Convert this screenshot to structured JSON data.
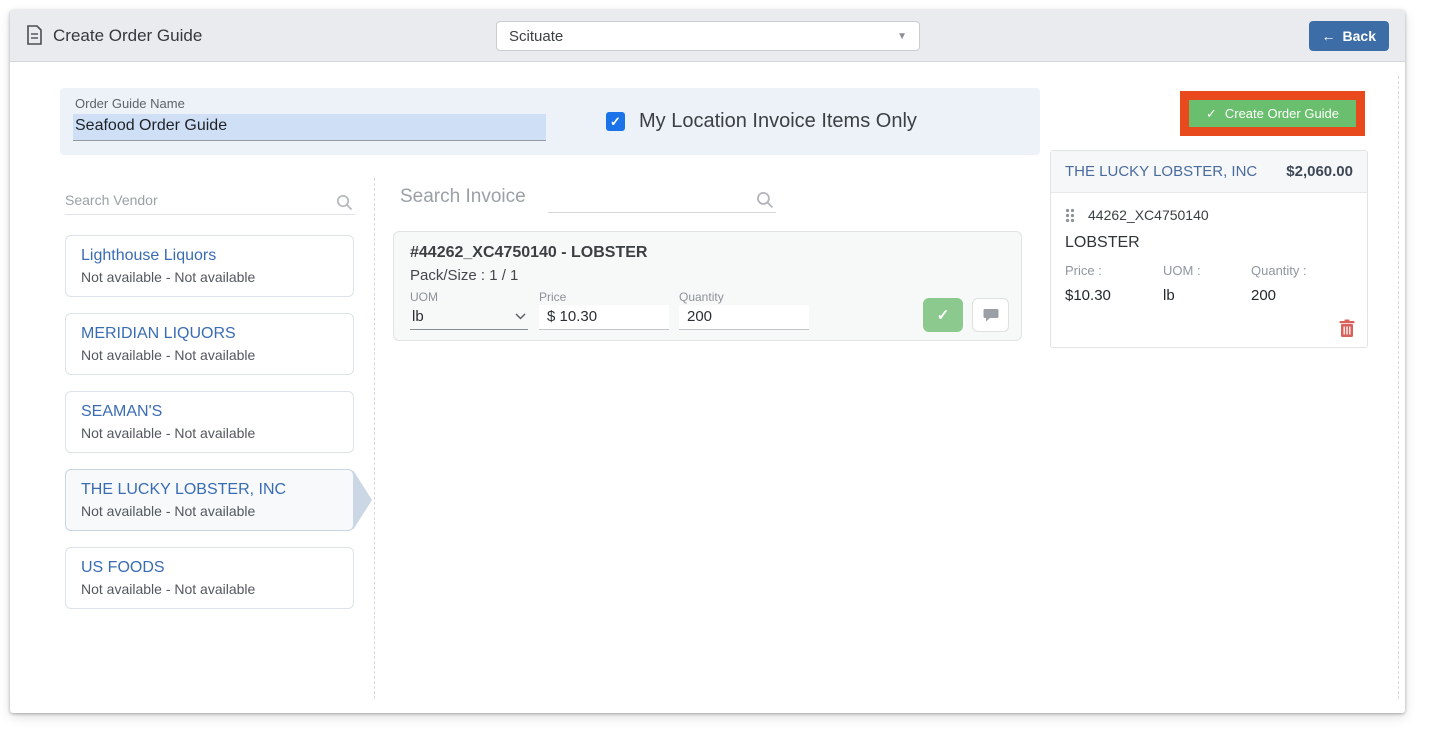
{
  "header": {
    "title": "Create Order Guide",
    "location_dropdown": {
      "value": "Scituate"
    },
    "back_button": {
      "label": "Back"
    }
  },
  "form": {
    "order_guide_name": {
      "label": "Order Guide Name",
      "value": "Seafood Order Guide"
    },
    "my_location_checkbox": {
      "label": "My Location Invoice Items Only",
      "checked": true
    }
  },
  "vendors": {
    "search_placeholder": "Search Vendor",
    "items": [
      {
        "name": "Lighthouse Liquors",
        "availability": "Not available - Not available",
        "selected": false
      },
      {
        "name": "MERIDIAN LIQUORS",
        "availability": "Not available - Not available",
        "selected": false
      },
      {
        "name": "SEAMAN'S",
        "availability": "Not available - Not available",
        "selected": false
      },
      {
        "name": "THE LUCKY LOBSTER, INC",
        "availability": "Not available - Not available",
        "selected": true
      },
      {
        "name": "US FOODS",
        "availability": "Not available - Not available",
        "selected": false
      }
    ]
  },
  "invoice": {
    "search_label": "Search Invoice",
    "item": {
      "title": "#44262_XC4750140 - LOBSTER",
      "pack_size": "Pack/Size : 1 / 1",
      "uom": {
        "label": "UOM",
        "value": "lb"
      },
      "price": {
        "label": "Price",
        "value": "$ 10.30"
      },
      "quantity": {
        "label": "Quantity",
        "value": "200"
      }
    }
  },
  "summary": {
    "create_button": {
      "label": "Create Order Guide"
    },
    "vendor_name": "THE LUCKY LOBSTER, INC",
    "total": "$2,060.00",
    "item": {
      "code": "44262_XC4750140",
      "name": "LOBSTER",
      "price_label": "Price :",
      "price": "$10.30",
      "uom_label": "UOM :",
      "uom": "lb",
      "quantity_label": "Quantity :",
      "quantity": "200"
    }
  },
  "icons": {
    "back_arrow": "←",
    "check": "✓",
    "caret_down": "▼",
    "chevron_down": "⌄"
  },
  "colors": {
    "accent-green": "#6abf6e",
    "soft-green": "#8bc98e",
    "annotation-red": "#e8491d",
    "link-blue": "#3a6cb4",
    "back-blue": "#3d6da6",
    "checkbox-blue": "#1a73e8",
    "danger-red": "#d9615c",
    "summary-blue": "#4a6b9d"
  }
}
